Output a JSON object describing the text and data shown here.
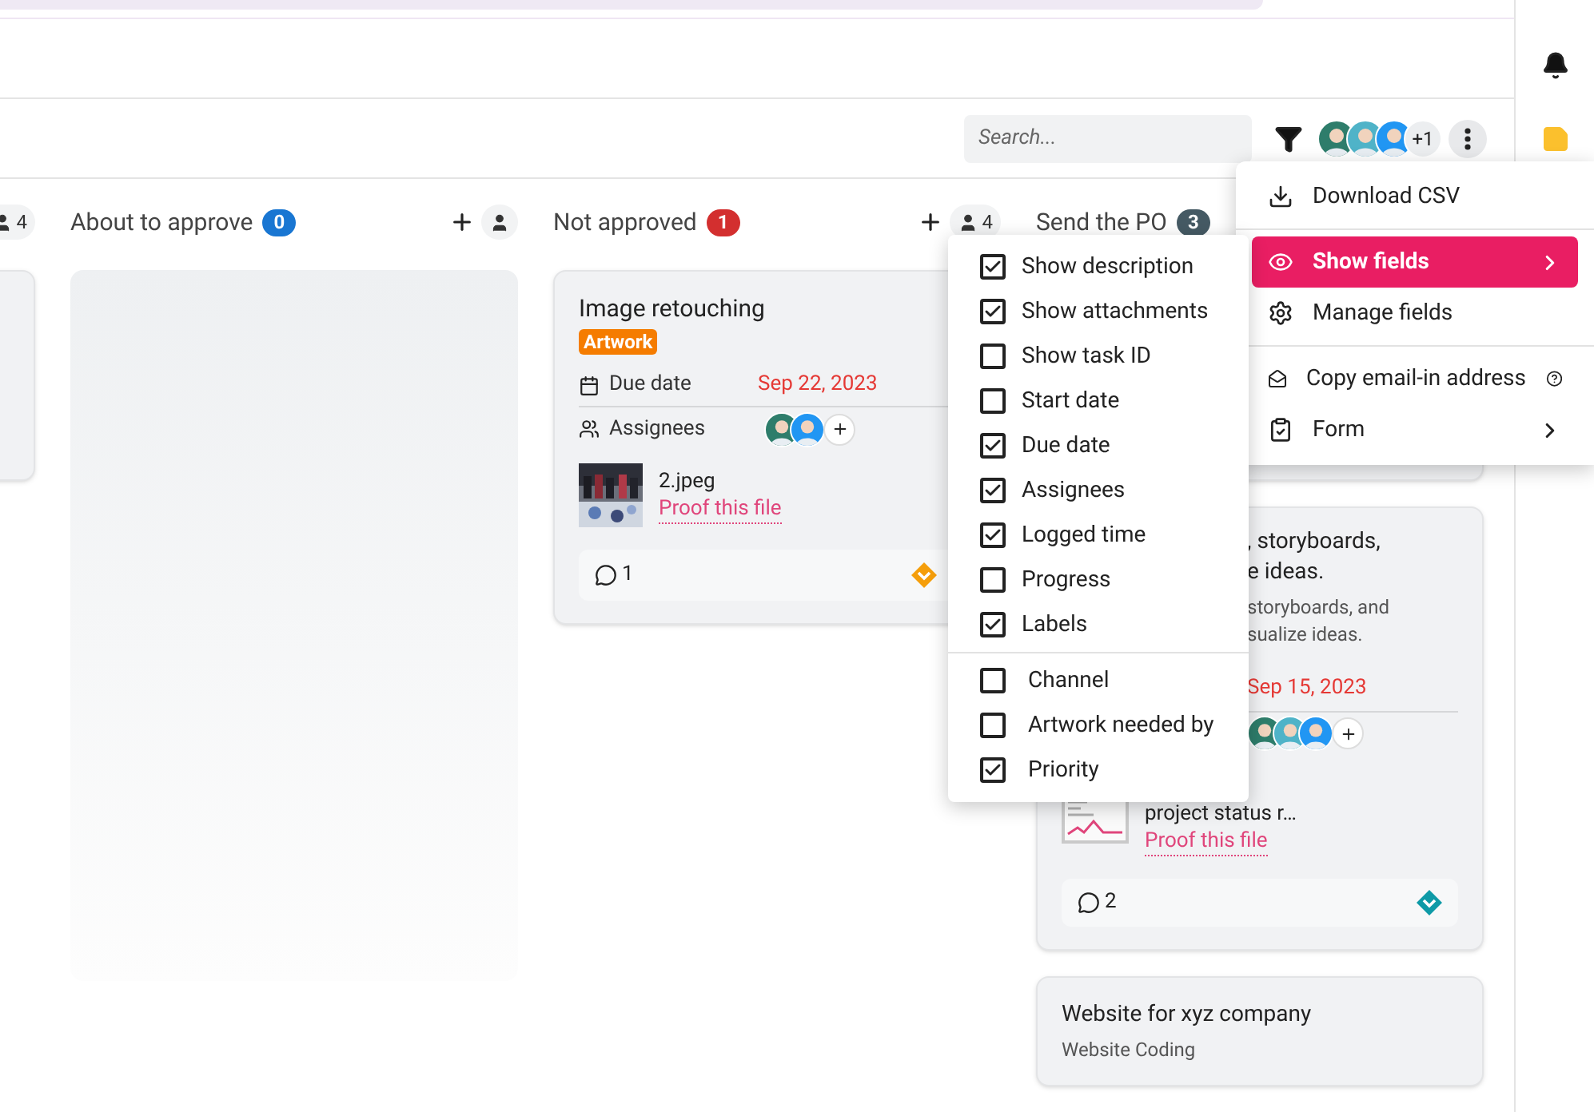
{
  "toolbar": {
    "search": {
      "placeholder": "Search..."
    },
    "members": [
      {
        "color": "#2e7d6b"
      },
      {
        "color": "#4fb3c8"
      },
      {
        "color": "#2196f3"
      }
    ],
    "members_extra": "+1"
  },
  "columns": [
    {
      "kind": "edge",
      "member_count": "4",
      "cards": [
        {
          "kind": "blank"
        }
      ]
    },
    {
      "kind": "full",
      "title": "About to approve",
      "count": "0",
      "color": "#1976d2",
      "show_add": true,
      "cards": [
        {
          "kind": "placeholder"
        }
      ]
    },
    {
      "kind": "full",
      "title": "Not approved",
      "count": "1",
      "color": "#d32f2f",
      "show_add": true,
      "member_count": "4",
      "cards": [
        {
          "kind": "task",
          "title": "Image retouching",
          "tag": {
            "label": "Artwork",
            "color": "#f57c00"
          },
          "due_label": "Due date",
          "due_date": "Sep 22, 2023",
          "assignees_label": "Assignees",
          "assignees": [
            {
              "color": "#2e7d6b"
            },
            {
              "color": "#2196f3"
            }
          ],
          "attachment": {
            "name": "2.jpeg",
            "action": "Proof this file"
          },
          "comments": "1",
          "priority": {
            "color": "#f59e0b"
          }
        }
      ]
    },
    {
      "kind": "full",
      "title": "Send the PO",
      "count": "3",
      "color": "#455a64",
      "cards": [
        {
          "kind": "blank"
        },
        {
          "kind": "partial",
          "title_lines": [
            ", storyboards,",
            "e ideas."
          ],
          "description_lines": [
            "storyboards, and",
            "sualize ideas."
          ],
          "due_date": "Sep 15, 2023",
          "assignees": [
            {
              "color": "#2e7d6b"
            },
            {
              "color": "#4fb3c8"
            },
            {
              "color": "#2196f3"
            }
          ],
          "attachment": {
            "name": "project status r…",
            "action": "Proof this file"
          },
          "comments": "2",
          "priority": {
            "color": "#0e9aa7"
          }
        },
        {
          "kind": "simple",
          "title": "Website for xyz company",
          "subtitle": "Website Coding"
        }
      ]
    }
  ],
  "menu": {
    "groups": [
      [
        {
          "label": "Download CSV",
          "selected": false,
          "submenu": false
        }
      ],
      [
        {
          "label": "Show fields",
          "selected": true,
          "submenu": true
        },
        {
          "label": "Manage fields",
          "selected": false,
          "submenu": false
        }
      ],
      [
        {
          "label": "Copy email-in address",
          "selected": false,
          "submenu": false,
          "help": true
        },
        {
          "label": "Form",
          "selected": false,
          "submenu": true
        }
      ]
    ]
  },
  "submenu": {
    "groups": [
      [
        {
          "label": "Show description",
          "checked": true
        },
        {
          "label": "Show attachments",
          "checked": true
        },
        {
          "label": "Show task ID",
          "checked": false
        },
        {
          "label": "Start date",
          "checked": false
        },
        {
          "label": "Due date",
          "checked": true
        },
        {
          "label": "Assignees",
          "checked": true
        },
        {
          "label": "Logged time",
          "checked": true
        },
        {
          "label": "Progress",
          "checked": false
        },
        {
          "label": "Labels",
          "checked": true
        }
      ],
      [
        {
          "label": "Channel",
          "checked": false
        },
        {
          "label": "Artwork needed by",
          "checked": false
        },
        {
          "label": "Priority",
          "checked": true
        }
      ]
    ]
  }
}
